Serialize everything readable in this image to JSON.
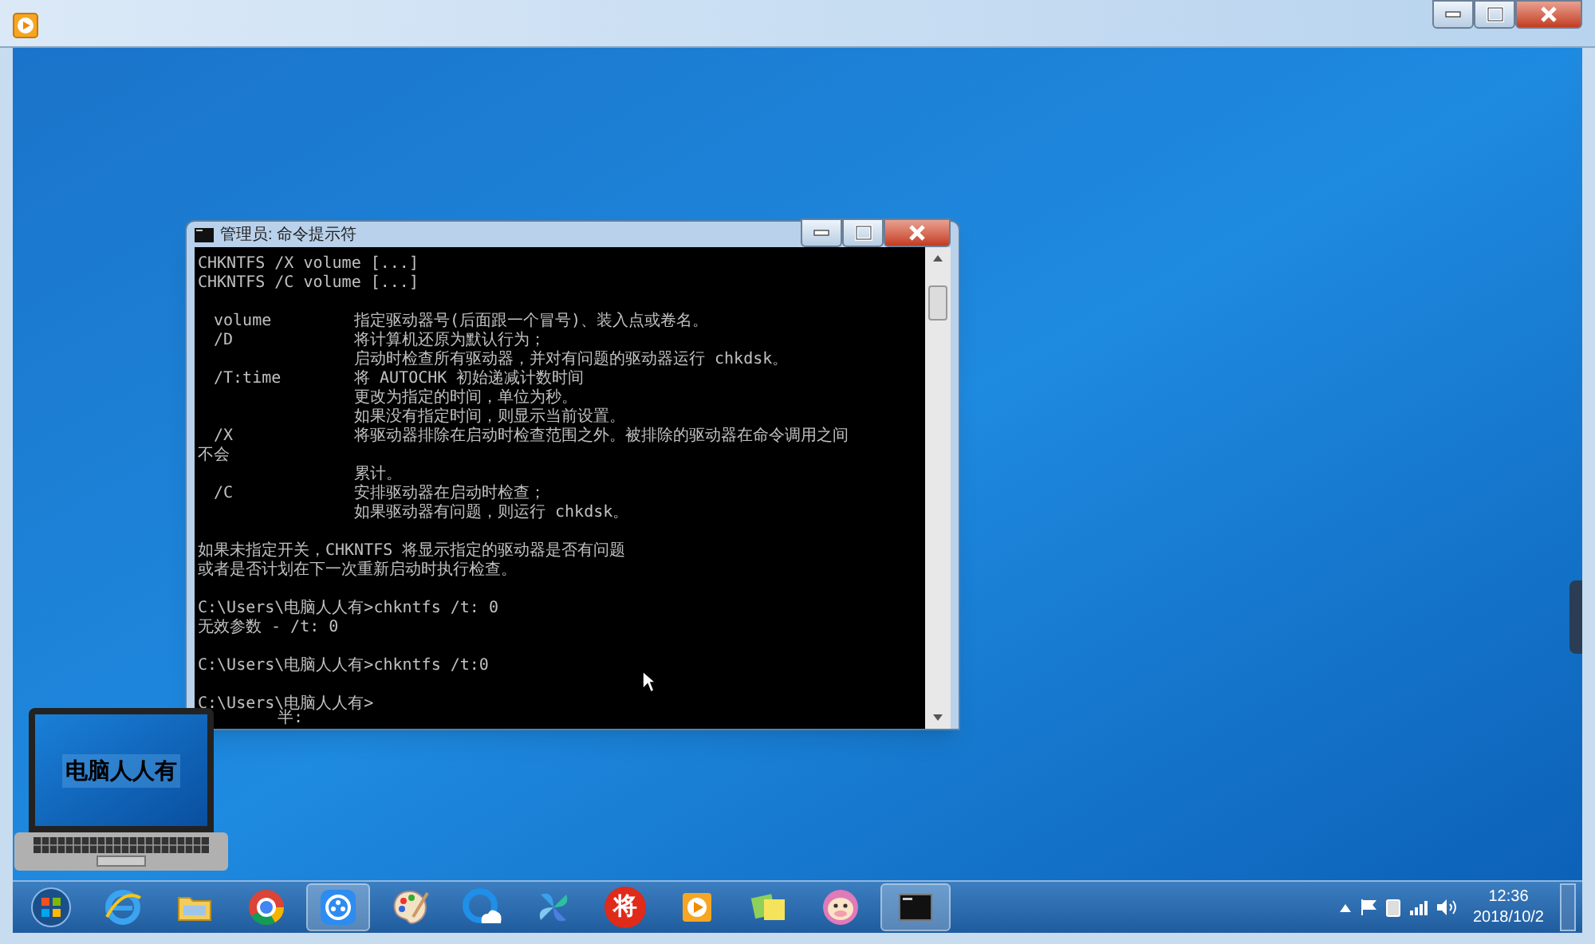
{
  "player_window": {
    "buttons": [
      {
        "kind": "minimize"
      },
      {
        "kind": "maximize"
      },
      {
        "kind": "close"
      }
    ]
  },
  "console_window": {
    "title": "管理员: 命令提示符",
    "blocks": [
      [
        {
          "text": "CHKNTFS /X volume [...]"
        },
        {
          "text": "CHKNTFS /C volume [...]"
        }
      ],
      [
        {
          "option": "volume",
          "desc": "指定驱动器号(后面跟一个冒号)、装入点或卷名。"
        },
        {
          "option": "/D",
          "desc": "将计算机还原为默认行为；"
        },
        {
          "desc": "启动时检查所有驱动器，并对有问题的驱动器运行 chkdsk。"
        },
        {
          "option": "/T:time",
          "desc": "将 AUTOCHK 初始递减计数时间"
        },
        {
          "desc": "更改为指定的时间，单位为秒。"
        },
        {
          "desc": "如果没有指定时间，则显示当前设置。"
        },
        {
          "option": "/X",
          "desc": "将驱动器排除在启动时检查范围之外。被排除的驱动器在命令调用之间"
        },
        {
          "text": "不会"
        },
        {
          "desc": "累计。"
        },
        {
          "option": "/C",
          "desc": "安排驱动器在启动时检查；"
        },
        {
          "desc": "如果驱动器有问题，则运行 chkdsk。"
        }
      ],
      [
        {
          "text": "如果未指定开关，CHKNTFS 将显示指定的驱动器是否有问题"
        },
        {
          "text": "或者是否计划在下一次重新启动时执行检查。"
        }
      ],
      [
        {
          "text": "C:\\Users\\电脑人人有>chkntfs /t: 0"
        },
        {
          "text": "无效参数 - /t: 0"
        }
      ],
      [
        {
          "text": "C:\\Users\\电脑人人有>chkntfs /t:0"
        }
      ],
      [
        {
          "text": "C:\\Users\\电脑人人有>"
        }
      ]
    ],
    "ime_text": "半:"
  },
  "logo": {
    "text": "电脑人人有"
  },
  "taskbar": {
    "items": [
      {
        "kind": "start",
        "active": false
      },
      {
        "kind": "browser-e",
        "active": false
      },
      {
        "kind": "folder",
        "active": false
      },
      {
        "kind": "chrome",
        "active": false
      },
      {
        "kind": "video",
        "active": true
      },
      {
        "kind": "palette",
        "active": false
      },
      {
        "kind": "cloud",
        "active": false
      },
      {
        "kind": "pinwheel",
        "active": false
      },
      {
        "kind": "glyph",
        "label": "将",
        "active": false
      },
      {
        "kind": "player",
        "active": false
      },
      {
        "kind": "notes",
        "active": false
      },
      {
        "kind": "cow",
        "active": false
      },
      {
        "kind": "console",
        "active": true
      }
    ],
    "tray": {
      "time": "12:36",
      "date": "2018/10/2"
    }
  }
}
